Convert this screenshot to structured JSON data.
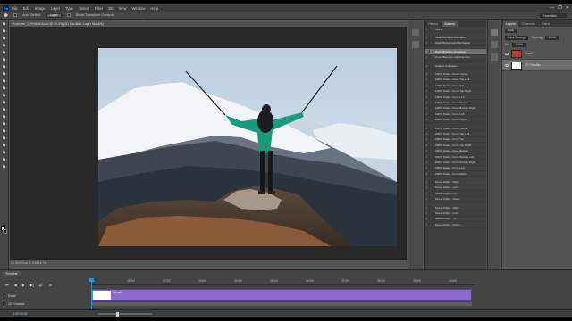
{
  "menubar": {
    "logo": "Ps",
    "items": [
      "File",
      "Edit",
      "Image",
      "Layer",
      "Type",
      "Select",
      "Filter",
      "3D",
      "View",
      "Window",
      "Help"
    ],
    "controls": [
      "—",
      "❐",
      "✕"
    ]
  },
  "options": {
    "autoselect_label": "Auto-Select:",
    "layer_dropdown": "Layer",
    "show_transform": "Show Transform Controls",
    "workspace": "Essentials"
  },
  "document": {
    "tab_title": "Example_1_Finished.psd @ 33.3% (3D Parallax, Layer Mask/8) *",
    "status": "33.33%   Doc: 3.10M/14.7M"
  },
  "actions_panel": {
    "tabs": [
      "History",
      "Actions"
    ],
    "active_tab": "Actions",
    "rows": [
      {
        "label": "Set 1",
        "check": "✓",
        "selected": false
      },
      {
        "gap": true
      },
      {
        "label": "Clear Subpixel Animation",
        "check": "✓",
        "selected": false
      },
      {
        "label": "Clear Background Animation",
        "check": "✓",
        "selected": false
      },
      {
        "gap": true
      },
      {
        "label": "Zoom/Position Animation",
        "check": "✓",
        "selected": true
      },
      {
        "label": "Zoom/Background Animation",
        "check": "✓",
        "selected": false
      },
      {
        "gap": true
      },
      {
        "label": "Subject Animation",
        "check": "✓",
        "selected": false
      },
      {
        "gap": true
      },
      {
        "label": "100% Scale - From Center",
        "check": "✓",
        "selected": false
      },
      {
        "label": "100% Scale - From Top Left",
        "check": "✓",
        "selected": false
      },
      {
        "label": "100% Scale - From Top",
        "check": "✓",
        "selected": false
      },
      {
        "label": "100% Scale - From Top Right",
        "check": "✓",
        "selected": false
      },
      {
        "label": "100% Scale - From Left",
        "check": "✓",
        "selected": false
      },
      {
        "label": "100% Scale - From Bottom",
        "check": "✓",
        "selected": false
      },
      {
        "label": "100% Scale - From Bottom Right",
        "check": "✓",
        "selected": false
      },
      {
        "label": "100% Scale - From Left",
        "check": "✓",
        "selected": false
      },
      {
        "label": "100% Scale - From Right",
        "check": "✓",
        "selected": false
      },
      {
        "gap": true
      },
      {
        "label": "200% Scale - From Center",
        "check": "✓",
        "selected": false
      },
      {
        "label": "200% Scale - From Top Left",
        "check": "✓",
        "selected": false
      },
      {
        "label": "200% Scale - From Top",
        "check": "✓",
        "selected": false
      },
      {
        "label": "200% Scale - From Top Right",
        "check": "✓",
        "selected": false
      },
      {
        "label": "200% Scale - From Bottom",
        "check": "✓",
        "selected": false
      },
      {
        "label": "200% Scale - From Bottom Left",
        "check": "✓",
        "selected": false
      },
      {
        "label": "200% Scale - From Bottom Right",
        "check": "✓",
        "selected": false
      },
      {
        "label": "200% Scale - From Left",
        "check": "✓",
        "selected": false
      },
      {
        "label": "200% Scale - From Right",
        "check": "✓",
        "selected": false
      },
      {
        "gap": true
      },
      {
        "label": "Move 100px - Right",
        "check": "✓",
        "selected": false
      },
      {
        "label": "Move 100px - Left",
        "check": "✓",
        "selected": false
      },
      {
        "label": "Move 100px - Up",
        "check": "✓",
        "selected": false
      },
      {
        "label": "Move 100px - Down",
        "check": "✓",
        "selected": false
      },
      {
        "gap": true
      },
      {
        "label": "Move 200px - Right",
        "check": "✓",
        "selected": false
      },
      {
        "label": "Move 200px - Left",
        "check": "✓",
        "selected": false
      },
      {
        "label": "Move 200px - Up",
        "check": "✓",
        "selected": false
      },
      {
        "label": "Move 200px - Down",
        "check": "✓",
        "selected": false
      }
    ]
  },
  "layers_panel": {
    "tabs": [
      "Layers",
      "Channels",
      "Paths"
    ],
    "active_tab": "Layers",
    "kind_filter": "Kind",
    "blend_mode": "Pass Through",
    "opacity_label": "Opacity:",
    "opacity": "100%",
    "fill_label": "Fill:",
    "fill": "100%",
    "layers": [
      {
        "name": "Small",
        "selected": false,
        "thumb_color": "#c0392b"
      },
      {
        "name": "3D Parallax",
        "selected": true,
        "thumb_color": "#ffffff"
      }
    ]
  },
  "timeline": {
    "tab": "Timeline",
    "controls": [
      "⏮",
      "◀",
      "▶",
      "▶|",
      "🔊",
      "⚙"
    ],
    "ticks": [
      "00",
      "01:00f",
      "02:00f",
      "03:00f",
      "04:00f",
      "05:00f",
      "06:00f",
      "07:00f",
      "08:00f",
      "09:00f",
      "10:00f"
    ],
    "tracks": [
      {
        "name": "Small"
      },
      {
        "name": "3D Parallax"
      }
    ],
    "clip_name": "Small",
    "timecode": "0:00:00:00"
  },
  "colors": {
    "accent": "#3a8de0",
    "clip": "#8b6bc9",
    "panel": "#535353"
  }
}
